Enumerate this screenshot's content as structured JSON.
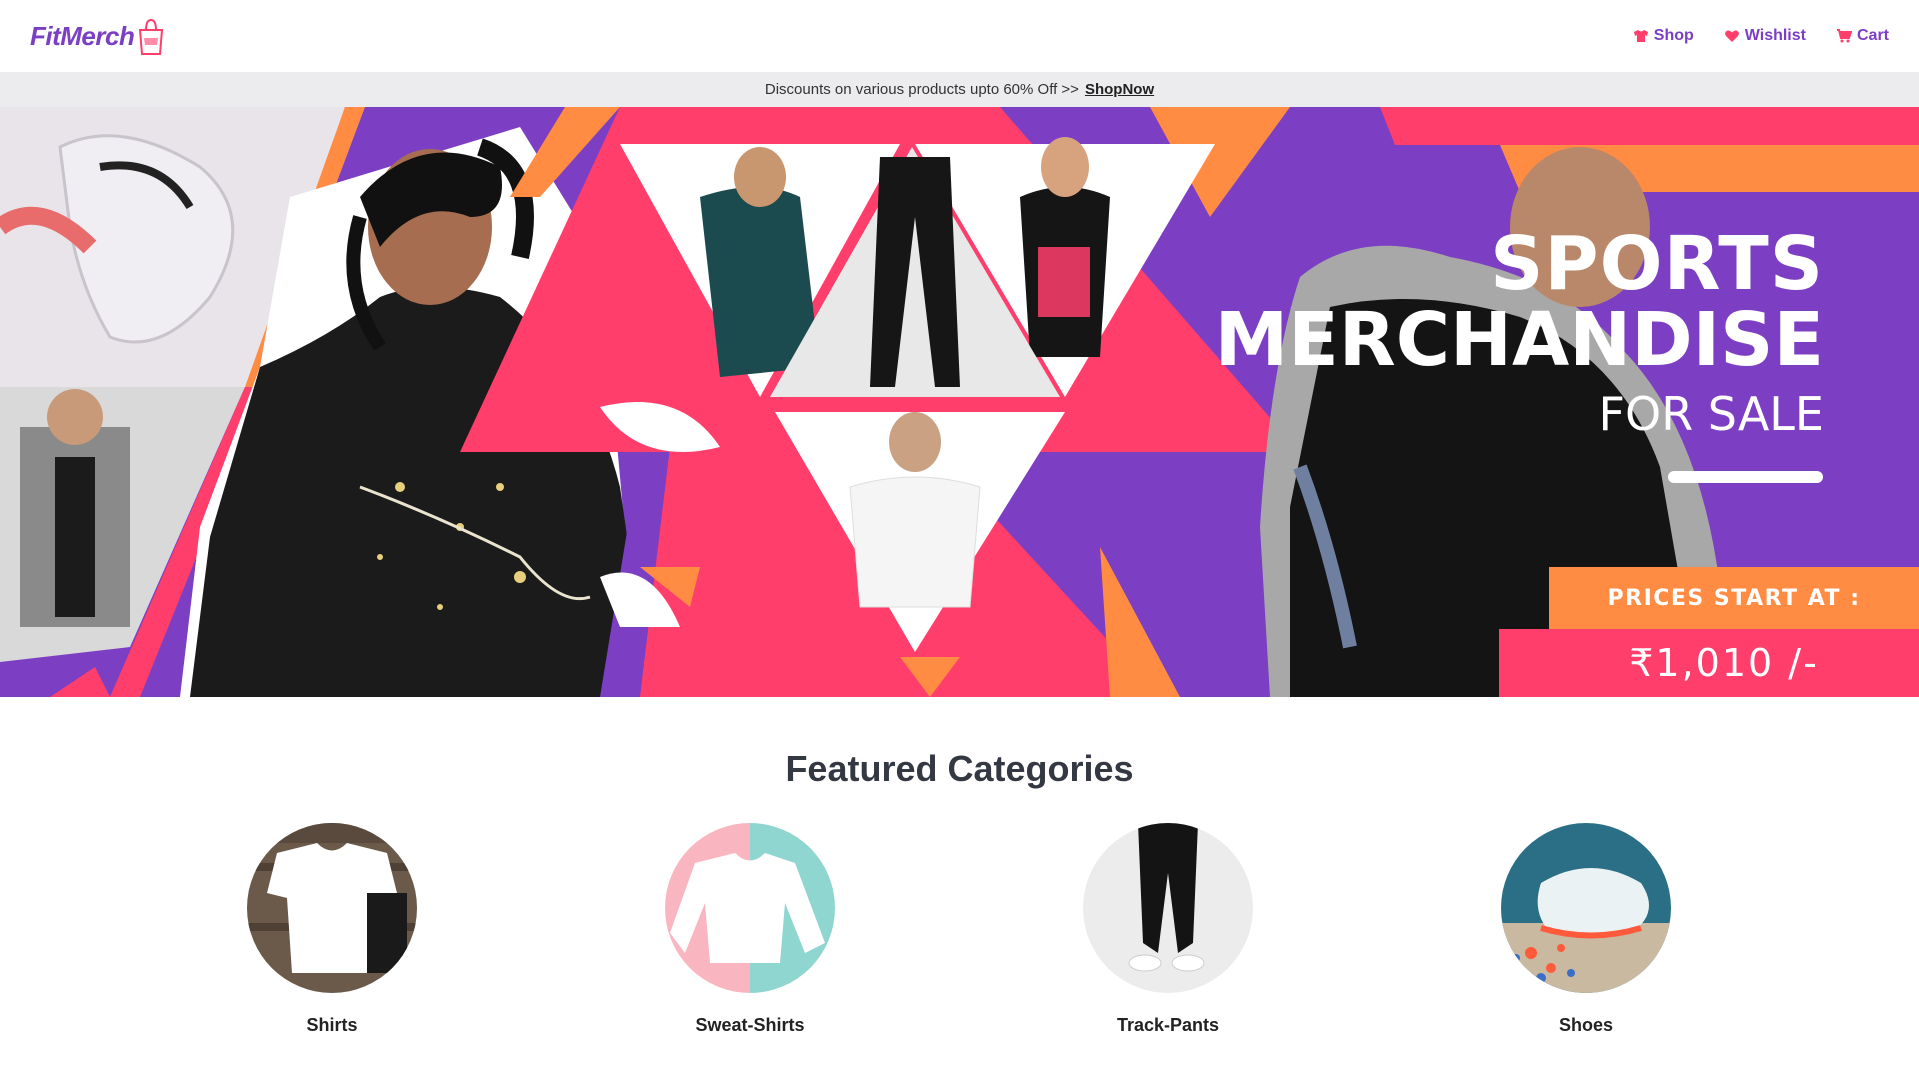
{
  "header": {
    "logo_text": "FitMerch",
    "nav": [
      {
        "label": "Shop",
        "icon": "shirt-icon"
      },
      {
        "label": "Wishlist",
        "icon": "heart-icon"
      },
      {
        "label": "Cart",
        "icon": "cart-icon"
      }
    ]
  },
  "promo": {
    "text": "Discounts on various products upto 60% Off >>",
    "link": "ShopNow"
  },
  "hero": {
    "line1": "SPORTS",
    "line2": "MERCHANDISE",
    "line3": "FOR SALE",
    "price_label": "PRICES START AT :",
    "price_value": "₹1,010 /-",
    "colors": {
      "purple": "#7c3fc3",
      "pink": "#ff3e6c",
      "orange": "#ff8c42"
    }
  },
  "featured": {
    "title": "Featured Categories",
    "categories": [
      {
        "label": "Shirts"
      },
      {
        "label": "Sweat-Shirts"
      },
      {
        "label": "Track-Pants"
      },
      {
        "label": "Shoes"
      }
    ]
  },
  "colors": {
    "brand": "#7b3fc4",
    "accent_pink": "#ff3e6c"
  }
}
